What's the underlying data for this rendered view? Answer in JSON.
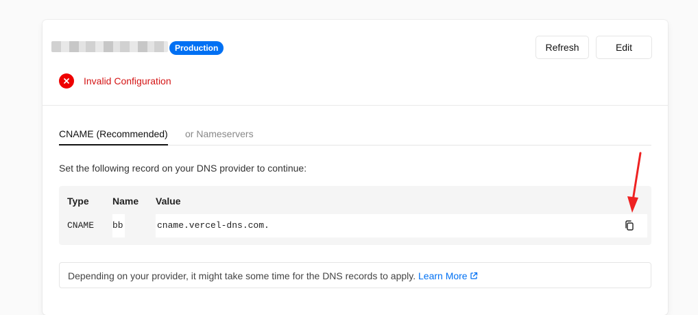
{
  "header": {
    "environment_badge": "Production",
    "refresh_label": "Refresh",
    "edit_label": "Edit"
  },
  "status": {
    "text": "Invalid Configuration",
    "icon": "x-circle-icon",
    "color": "#e00000"
  },
  "tabs": [
    {
      "label": "CNAME (Recommended)",
      "active": true
    },
    {
      "label": "or Nameservers",
      "active": false
    }
  ],
  "instruction": "Set the following record on your DNS provider to continue:",
  "record_table": {
    "columns": [
      "Type",
      "Name",
      "Value"
    ],
    "rows": [
      {
        "type": "CNAME",
        "name": "bb",
        "value": "cname.vercel-dns.com."
      }
    ]
  },
  "note": {
    "text": "Depending on your provider, it might take some time for the DNS records to apply.",
    "link_label": "Learn More",
    "link_icon": "external-link-icon"
  },
  "colors": {
    "accent": "#0070f3",
    "error": "#e00000",
    "annotation_arrow": "#ee2222"
  }
}
